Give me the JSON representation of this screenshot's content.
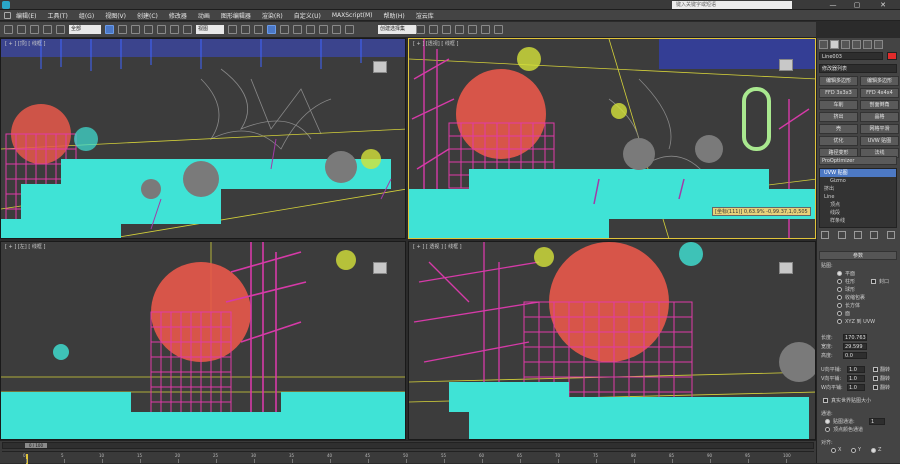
{
  "titlebar": {
    "search_placeholder": "键入关键字或短语",
    "minimize": "—",
    "maximize": "▢",
    "close": "✕"
  },
  "menu": [
    "编辑(E)",
    "工具(T)",
    "组(G)",
    "视图(V)",
    "创建(C)",
    "修改器",
    "动画",
    "图形编辑器",
    "渲染(R)",
    "自定义(U)",
    "MAXScript(M)",
    "帮助(H)",
    "渲云库"
  ],
  "toolbar": {
    "selection_filter": "全部",
    "ref_coord": "视图",
    "named_selection": "创建选择集"
  },
  "viewports": {
    "top": "[ + ] [顶] [ 线框 ]",
    "perspective": "[ + ] [透视] [ 线框 ]",
    "left": "[ + ] [左] [ 线框 ]",
    "user": "[ + ] [ 透视 ] [ 线框 ]",
    "coord_tooltip": "[坐标(111)] 0,63.9% -0,99.37,1,0,505"
  },
  "command_panel": {
    "object_name": "Line003",
    "modifier_list": "修改器列表",
    "modifier_buttons": [
      "编辑多边形",
      "编辑多边形",
      "FFD 3x3x3",
      "FFD 4x4x4",
      "车削",
      "剖面倒角",
      "挤出",
      "晶格",
      "壳",
      "网格平滑",
      "优化",
      "UVW 贴图",
      "路径变形",
      "法线"
    ],
    "prooptimizer": "ProOptimizer",
    "stack": [
      {
        "label": "UVW 贴图",
        "selected": true,
        "sub": false
      },
      {
        "label": "Gizmo",
        "selected": false,
        "sub": true
      },
      {
        "label": "挤出",
        "selected": false,
        "sub": false
      },
      {
        "label": "Line",
        "selected": false,
        "sub": false
      },
      {
        "label": "顶点",
        "selected": false,
        "sub": true
      },
      {
        "label": "线段",
        "selected": false,
        "sub": true
      },
      {
        "label": "样条线",
        "selected": false,
        "sub": true
      }
    ],
    "params_title": "参数",
    "mapping_label": "贴图:",
    "mapping_options": [
      "平面",
      "柱形",
      "球形",
      "收缩包裹",
      "长方体",
      "面",
      "XYZ 到 UVW"
    ],
    "cap_label": "封口",
    "length_label": "长度:",
    "length_value": "170.763",
    "width_label": "宽度:",
    "width_value": "29.599",
    "height_label": "高度:",
    "height_value": "0.0",
    "u_tile_label": "U向平铺:",
    "u_tile_value": "1.0",
    "v_tile_label": "V向平铺:",
    "v_tile_value": "1.0",
    "w_tile_label": "W向平铺:",
    "w_tile_value": "1.0",
    "flip_label": "翻转",
    "real_world_label": "真实世界贴图大小",
    "channel_label": "通道:",
    "map_channel_label": "贴图通道:",
    "map_channel_value": "1",
    "vertex_color_label": "顶点颜色通道",
    "alignment_label": "对齐:",
    "axis_labels": [
      "X",
      "Y",
      "Z"
    ]
  },
  "timeline": {
    "slider_label": "0 / 100",
    "ticks": [
      "0",
      "5",
      "10",
      "15",
      "20",
      "25",
      "30",
      "35",
      "40",
      "45",
      "50",
      "55",
      "60",
      "65",
      "70",
      "75",
      "80",
      "85",
      "90",
      "95",
      "100"
    ]
  },
  "colors": {
    "accent": "#4d79c4",
    "active_border": "#e0c43a",
    "grid_magenta": "#e03aa8",
    "foliage_cyan": "#3fe3d6",
    "dome_red": "#e8584a"
  }
}
